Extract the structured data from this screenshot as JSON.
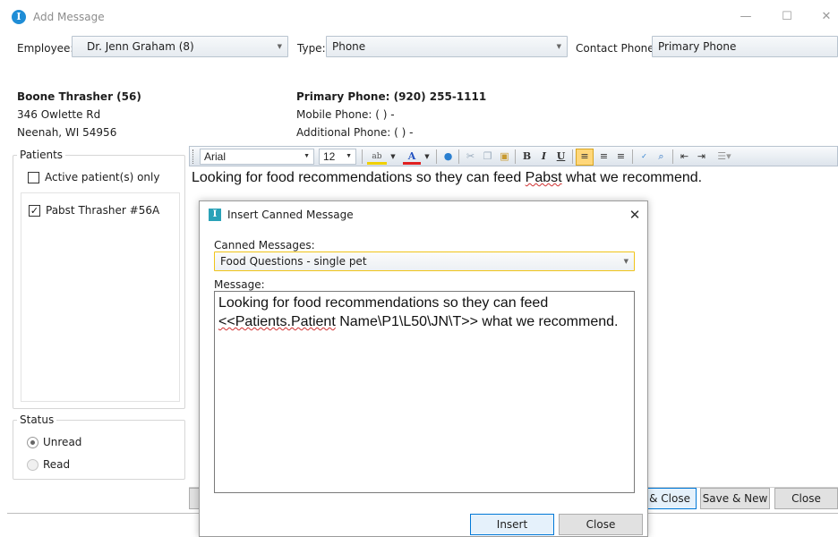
{
  "window": {
    "title": "Add Message",
    "minimize": "—",
    "maximize": "☐",
    "close": "✕"
  },
  "header": {
    "employee_label": "Employee:",
    "employee_value": "Dr. Jenn Graham (8)",
    "type_label": "Type:",
    "type_value": "Phone",
    "contact_phone_label": "Contact Phone:",
    "contact_phone_value": "Primary Phone"
  },
  "client": {
    "name": "Boone Thrasher (56)",
    "address1": "346 Owlette Rd",
    "address2": "Neenah, WI 54956",
    "primary_phone": "Primary Phone: (920) 255-1111",
    "mobile_phone": "Mobile Phone: (  )   -",
    "additional_phone": "Additional Phone: (  )   -"
  },
  "patients": {
    "legend": "Patients",
    "active_only_label": "Active patient(s) only",
    "active_only_checked": false,
    "items": [
      {
        "label": "Pabst Thrasher #56A",
        "checked": true
      }
    ]
  },
  "status": {
    "legend": "Status",
    "options": [
      "Unread",
      "Read"
    ],
    "selected": "Unread"
  },
  "toolbar": {
    "font": "Arial",
    "size": "12",
    "icons": [
      "highlight-icon",
      "font-color-icon",
      "insert-link-icon",
      "cut-icon",
      "copy-icon",
      "paste-icon",
      "bold-icon",
      "italic-icon",
      "underline-icon",
      "align-left-icon",
      "align-center-icon",
      "align-right-icon",
      "spellcheck-icon",
      "find-icon",
      "outdent-icon",
      "indent-icon",
      "list-icon"
    ]
  },
  "editor": {
    "text_before": "Looking for food recommendations so they can feed ",
    "text_misspelled": "Pabst",
    "text_after": " what we recommend."
  },
  "footer": {
    "save_close": "Save & Close",
    "save_new": "Save & New",
    "close": "Close"
  },
  "dialog": {
    "title": "Insert Canned Message",
    "close": "✕",
    "canned_label": "Canned Messages:",
    "canned_value": "Food Questions - single pet",
    "message_label": "Message:",
    "message_line1": "Looking for food recommendations so they can feed",
    "message_line2_misspelled": "<<Patients.Patient",
    "message_line2_rest": " Name\\P1\\L50\\JN\\T>> what we recommend.",
    "insert_button": "Insert",
    "close_button": "Close"
  },
  "colors": {
    "accent_blue": "#0078d7",
    "app_icon": "#1f8dd6",
    "dialog_icon": "#2aa2b8",
    "highlight_border": "#f0c419"
  }
}
